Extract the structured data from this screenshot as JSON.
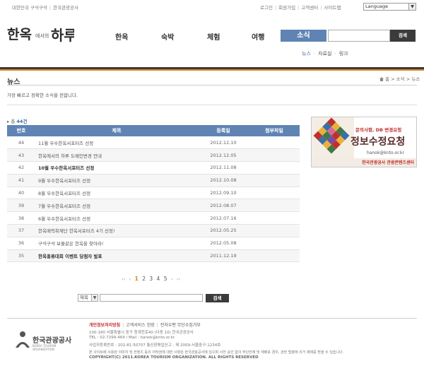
{
  "topbar": {
    "left_links": [
      "대한민국 구석구석",
      "한국관광공사"
    ],
    "right_links": [
      "로그인",
      "회원가입",
      "고객센터",
      "사이트맵"
    ],
    "language_label": "Language"
  },
  "header": {
    "logo_text": "한옥에서의 하루",
    "gnb": [
      "한옥",
      "숙박",
      "체험",
      "여행",
      "소식"
    ],
    "gnb_active": "소식",
    "search_button": "검색",
    "subnav": [
      "뉴스",
      "자료실",
      "링크"
    ],
    "subnav_active": "뉴스"
  },
  "page": {
    "title": "뉴스",
    "breadcrumb": [
      "홈",
      "소식",
      "뉴스"
    ],
    "description": "가장 빠르고 정확한 소식을 전합니다.",
    "total_label": "총",
    "total_count": "44건"
  },
  "table": {
    "headers": [
      "번호",
      "제목",
      "등록일",
      "첨부파일"
    ],
    "rows": [
      {
        "num": "44",
        "subject": "11월 우수한옥서포터즈 선정",
        "date": "2012.12.10",
        "bold": false
      },
      {
        "num": "43",
        "subject": "한옥에서의 하루 도메인변경 안내",
        "date": "2012.12.05",
        "bold": false
      },
      {
        "num": "42",
        "subject": "10월 우수한옥서포터즈 선정",
        "date": "2012.11.08",
        "bold": true
      },
      {
        "num": "41",
        "subject": "9월 우수한옥서포터즈 선정",
        "date": "2012.10.08",
        "bold": false
      },
      {
        "num": "40",
        "subject": "8월 우수한옥서포터즈 선정",
        "date": "2012.09.10",
        "bold": false
      },
      {
        "num": "39",
        "subject": "7월 우수한옥서포터즈 선정",
        "date": "2012.08.07",
        "bold": false
      },
      {
        "num": "38",
        "subject": "6월 우수한옥서포터즈 선정",
        "date": "2012.07.16",
        "bold": false
      },
      {
        "num": "37",
        "subject": "한옥매력취재단 한옥서포터즈 4기 선정!",
        "date": "2012.05.25",
        "bold": false
      },
      {
        "num": "36",
        "subject": "구석구석 보물같은 한옥을 찾아라!",
        "date": "2012.05.08",
        "bold": false
      },
      {
        "num": "35",
        "subject": "한옥홍류대회 이벤트 당첨자 발표",
        "date": "2011.12.19",
        "bold": true
      }
    ]
  },
  "banner": {
    "line1": "문의사항, DB 변경요청",
    "line2": "정보수정요청",
    "line3": "hanok@knto.or.kr",
    "line4": "한국관광공사 관광콘텐츠센터"
  },
  "pager": {
    "first": "‹‹",
    "prev": "‹",
    "pages": [
      "1",
      "2",
      "3",
      "4",
      "5"
    ],
    "current": "1",
    "next": "›",
    "last": "››"
  },
  "search": {
    "select_value": "제목",
    "button": "검색"
  },
  "footer": {
    "org_name": "한국관광공사",
    "org_eng": "KOREA TOURISM ORGANIZATION",
    "links": [
      "개인정보처리방침",
      "고객서비스 헌장",
      "전자우편 무단수집거부"
    ],
    "address": "100-180 서울특별시 중구 청계천로40 (다동 10) 한국관광공사",
    "contact": "TEL : 02-7299-464 / Mail : hanok@knto.or.kr",
    "business": "사업자등록번호 : 202-81-50707 통신판매업신고 : 제 2009-서울중구-1234호",
    "notice": "본 사이트에 사용된 이미지 및 컨텐츠 등의 저작권에 대한 사항은 한국관광공사에 있으며 사전 승인 없이 무단전재 및 재배포 경우, 관련 법령에 의거 제재를 받을 수 있습니다.",
    "copyright": "COPYRIGHT(C) 2011.KOREA TOURISM ORGANIZATION. ALL RIGHTS RESERVED"
  },
  "colors": {
    "accent_blue": "#5f84b4",
    "accent_orange": "#d9822b",
    "dark_bar": "#3f3a33",
    "button_dark": "#3b3b3b"
  }
}
